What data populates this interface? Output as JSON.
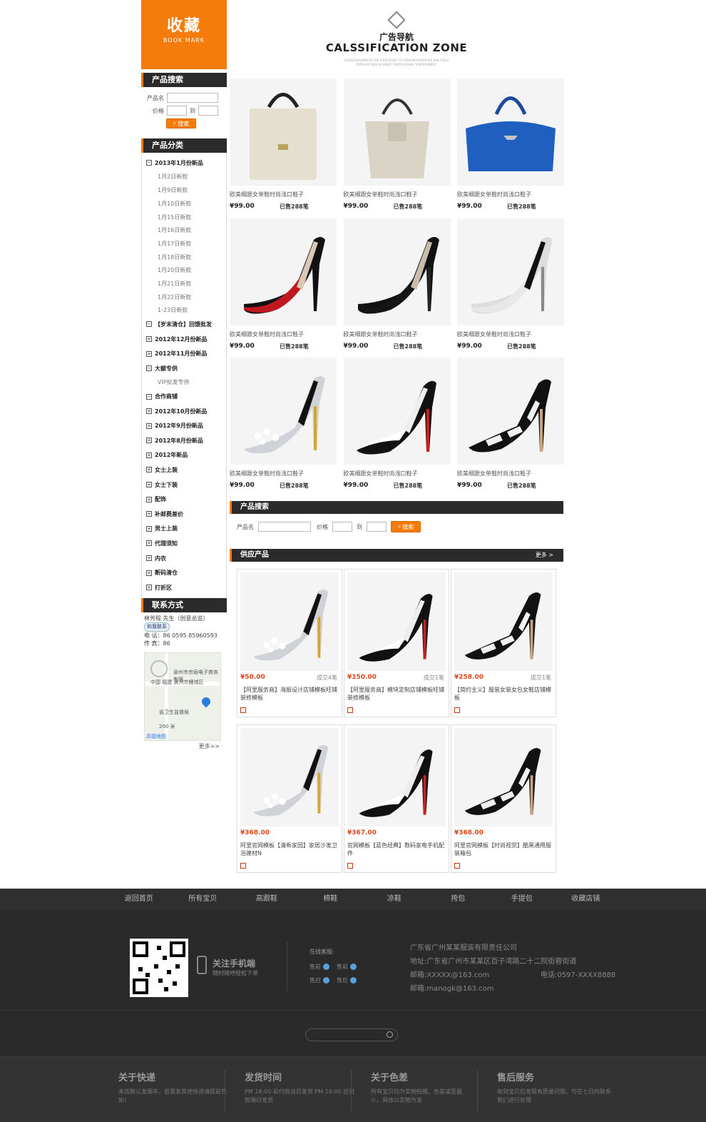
{
  "sidebar": {
    "bookmark_title": "收藏",
    "bookmark_sub": "BOOK MARK",
    "search_title": "产品搜索",
    "name_label": "产品名",
    "price_label": "价格",
    "to_label": "到",
    "search_btn": "搜索",
    "category_title": "产品分类",
    "categories": [
      {
        "label": "2013年1月份新品",
        "box": "−"
      },
      {
        "label": "【岁末清仓】回馈批发",
        "box": "−"
      },
      {
        "label": "2012年12月份新品",
        "box": "+"
      },
      {
        "label": "2012年11月份新品",
        "box": "+"
      },
      {
        "label": "大额专供",
        "box": "−"
      },
      {
        "label": "合作商铺",
        "box": "−"
      },
      {
        "label": "2012年10月份新品",
        "box": "+"
      },
      {
        "label": "2012年9月份新品",
        "box": "+"
      },
      {
        "label": "2012年8月份新品",
        "box": "+"
      },
      {
        "label": "2012年新品",
        "box": "+"
      },
      {
        "label": "女士上装",
        "box": "+"
      },
      {
        "label": "女士下装",
        "box": "+"
      },
      {
        "label": "配饰",
        "box": "+"
      },
      {
        "label": "补邮费差价",
        "box": "+"
      },
      {
        "label": "男士上装",
        "box": "+"
      },
      {
        "label": "代理须知",
        "box": "+"
      },
      {
        "label": "内衣",
        "box": "+"
      },
      {
        "label": "断码清仓",
        "box": "+"
      },
      {
        "label": "打折区",
        "box": "+"
      }
    ],
    "subcats_2013": [
      "1月2日新款",
      "1月9日新款",
      "1月10日新款",
      "1月15日新款",
      "1月16日新款",
      "1月17日新款",
      "1月18日新款",
      "1月20日新款",
      "1月21日新款",
      "1月22日新款",
      "1-23日新款"
    ],
    "subcat_vip": "VIP批发专供",
    "contact_title": "联系方式",
    "contact_name": "林芳程 先生（创意总监）",
    "contact_qq": "和我联系",
    "contact_tel": "电    话：86 0595 85960593",
    "contact_fax": "传    真：86",
    "map_text1": "泉州市宗丽电子商务有限",
    "map_text2": "中国 福建 泉州市鲤城区",
    "map_text3": "省卫生监督局",
    "map_scale": "200 米",
    "map_brand": "高德地图",
    "map_more": "更多>>"
  },
  "zone": {
    "cn": "广告导航",
    "en": "CALSSIFICATION ZONE",
    "tiny1": "QUEEN WALKING IN THE FOREFRONT OF FASHION WHATEVER SHE FEELS",
    "tiny2": "POPULAR NEW ELEMENT OVERFLOWING TEMPERAMENT"
  },
  "products": [
    {
      "name": "欧美细跟女单鞋时尚浅口鞋子",
      "price": "¥99.00",
      "sold": "已售288笔",
      "kind": "bag-white"
    },
    {
      "name": "欧美细跟女单鞋时尚浅口鞋子",
      "price": "¥99.00",
      "sold": "已售288笔",
      "kind": "bag-cream"
    },
    {
      "name": "欧美细跟女单鞋时尚浅口鞋子",
      "price": "¥99.00",
      "sold": "已售288笔",
      "kind": "bag-blue"
    },
    {
      "name": "欧美细跟女单鞋时尚浅口鞋子",
      "price": "¥99.00",
      "sold": "已售288笔",
      "kind": "shoe-red"
    },
    {
      "name": "欧美细跟女单鞋时尚浅口鞋子",
      "price": "¥99.00",
      "sold": "已售288笔",
      "kind": "shoe-black"
    },
    {
      "name": "欧美细跟女单鞋时尚浅口鞋子",
      "price": "¥99.00",
      "sold": "已售288笔",
      "kind": "shoe-white"
    },
    {
      "name": "欧美细跟女单鞋时尚浅口鞋子",
      "price": "¥99.00",
      "sold": "已售288笔",
      "kind": "shoe-flower"
    },
    {
      "name": "欧美细跟女单鞋时尚浅口鞋子",
      "price": "¥99.00",
      "sold": "已售288笔",
      "kind": "shoe-bw"
    },
    {
      "name": "欧美细跟女单鞋时尚浅口鞋子",
      "price": "¥99.00",
      "sold": "已售288笔",
      "kind": "shoe-stripe"
    }
  ],
  "main_search": {
    "title": "产品搜索",
    "name_label": "产品名",
    "price_label": "价格",
    "to_label": "到",
    "btn": "搜索"
  },
  "supply": {
    "title": "供应产品",
    "more": "更多 >",
    "items": [
      {
        "price": "¥50.00",
        "sold": "成交4笔",
        "name": "【阿里服务商】海报设计店铺模板旺铺装修模板",
        "kind": "shoe-flower"
      },
      {
        "price": "¥150.00",
        "sold": "成交1笔",
        "name": "【阿里服务商】模块定制店铺模板旺铺装修模板",
        "kind": "shoe-bw"
      },
      {
        "price": "¥258.00",
        "sold": "成交1笔",
        "name": "【简约主义】服装女装女包女鞋店铺模板",
        "kind": "shoe-stripe"
      },
      {
        "price": "¥368.00",
        "sold": "",
        "name": "阿里官网模板【清新家园】家居沙发卫浴建材N",
        "kind": "shoe-flower"
      },
      {
        "price": "¥367.00",
        "sold": "",
        "name": "官网模板【蓝色经典】数码家电手机配件",
        "kind": "shoe-bw"
      },
      {
        "price": "¥368.00",
        "sold": "",
        "name": "阿里官网模板【时尚视觉】酷黑通用服装箱包",
        "kind": "shoe-stripe"
      }
    ]
  },
  "footer": {
    "nav": [
      "返回首页",
      "所有宝贝",
      "高跟鞋",
      "棉鞋",
      "凉鞋",
      "挎包",
      "手提包",
      "收藏店铺"
    ],
    "follow": "关注手机端",
    "follow_sub": "随时随地轻松下单",
    "cs_title": "在线客服:",
    "cs": [
      "售前",
      "售前",
      "售后",
      "售后"
    ],
    "company": "广东省广州某某服装有限责任公司",
    "address": "地址:广东省广州市某某区百子湾路二十二院街蓉街道",
    "email1": "邮箱:XXXXX@163.com",
    "phone": "电话:0597-XXXX8888",
    "email2": "邮箱:manogk@163.com",
    "info": [
      {
        "h": "关于快递",
        "p": "本店默认发顺丰，若需发其他快递请提前告知！"
      },
      {
        "h": "发货时间",
        "p": "PM 16:00 前付款当日发货 PM 16:00 后付款隔日发货"
      },
      {
        "h": "关于色差",
        "p": "所有宝贝均为实物拍摄，色差减至最小，具体以实物为准"
      },
      {
        "h": "售后服务",
        "p": "收到宝贝后发现有质量问题，可在七日内联系我们进行处理"
      }
    ]
  },
  "colors": {
    "accent": "#f57b0a",
    "dark": "#2b2b2b",
    "price_red": "#e2461b"
  }
}
